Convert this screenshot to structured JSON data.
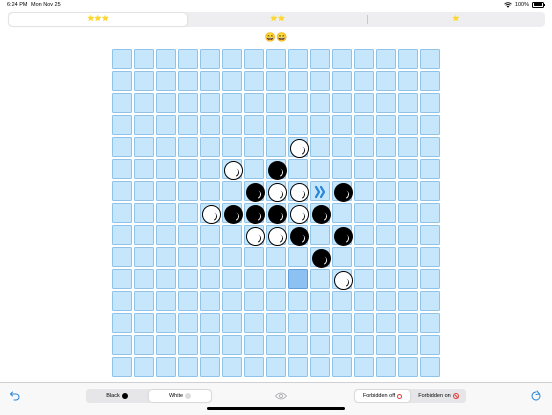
{
  "status": {
    "time": "6:24 PM",
    "date": "Mon Nov 25",
    "battery": "100%"
  },
  "levels": [
    {
      "label": "⭐⭐⭐",
      "selected": true
    },
    {
      "label": "⭐⭐",
      "selected": false
    },
    {
      "label": "⭐",
      "selected": false
    }
  ],
  "faces": "😄😄",
  "board": {
    "size": 15,
    "stones": [
      {
        "row": 4,
        "col": 8,
        "color": "white"
      },
      {
        "row": 5,
        "col": 5,
        "color": "white"
      },
      {
        "row": 5,
        "col": 7,
        "color": "black"
      },
      {
        "row": 6,
        "col": 6,
        "color": "black"
      },
      {
        "row": 6,
        "col": 7,
        "color": "white"
      },
      {
        "row": 6,
        "col": 8,
        "color": "white"
      },
      {
        "row": 6,
        "col": 10,
        "color": "black"
      },
      {
        "row": 7,
        "col": 4,
        "color": "white"
      },
      {
        "row": 7,
        "col": 5,
        "color": "black"
      },
      {
        "row": 7,
        "col": 6,
        "color": "black"
      },
      {
        "row": 7,
        "col": 7,
        "color": "black"
      },
      {
        "row": 7,
        "col": 8,
        "color": "white"
      },
      {
        "row": 7,
        "col": 9,
        "color": "black"
      },
      {
        "row": 8,
        "col": 6,
        "color": "white"
      },
      {
        "row": 8,
        "col": 7,
        "color": "white"
      },
      {
        "row": 8,
        "col": 8,
        "color": "black"
      },
      {
        "row": 8,
        "col": 10,
        "color": "black"
      },
      {
        "row": 9,
        "col": 9,
        "color": "black"
      },
      {
        "row": 10,
        "col": 10,
        "color": "white"
      }
    ],
    "hint_arrow": {
      "row": 6,
      "col": 9,
      "icon": "double-chevron-right-icon",
      "color": "#2b86d6"
    },
    "highlight": {
      "row": 10,
      "col": 8
    }
  },
  "bottom": {
    "color_options": [
      {
        "label": "Black",
        "dot": "black",
        "selected": false
      },
      {
        "label": "White",
        "dot": "white",
        "selected": true
      }
    ],
    "forbidden_options": [
      {
        "label": "Forbidden off",
        "icon": "red-ring-icon",
        "selected": true
      },
      {
        "label": "Forbidden on",
        "icon": "no-sign-icon",
        "selected": false
      }
    ]
  },
  "colors": {
    "cell": "#c5e6fb",
    "cell_border": "#8fc3e8",
    "accent": "#2b86d6",
    "star": "#e9a400",
    "forbid": "#e53a30"
  }
}
